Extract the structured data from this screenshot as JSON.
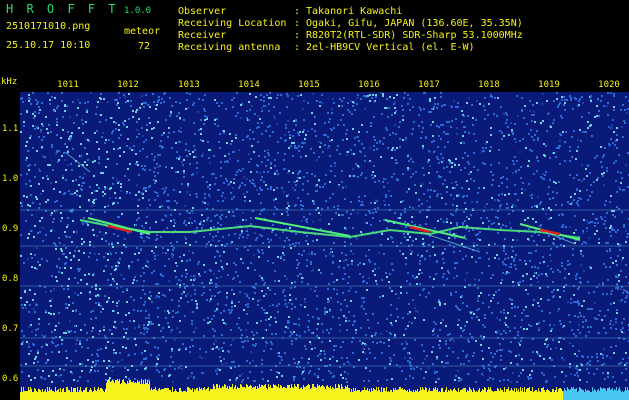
{
  "app": {
    "logo": "H R O F F T",
    "version": "1.0.0",
    "filename": "2510171010.png",
    "category": "meteor",
    "datetime": "25.10.17 10:10",
    "count": "72"
  },
  "meta": [
    {
      "label": "Observer",
      "value": "Takanori Kawachi"
    },
    {
      "label": "Receiving Location",
      "value": "Ogaki, Gifu, JAPAN (136.60E, 35.35N)"
    },
    {
      "label": "Receiver",
      "value": "R820T2(RTL-SDR) SDR-Sharp 53.1000MHz"
    },
    {
      "label": "Receiving antenna",
      "value": "2el-HB9CV Vertical (el. E-W)"
    }
  ],
  "axis": {
    "unit": "kHz",
    "x_ticks": [
      "1011",
      "1012",
      "1013",
      "1014",
      "1015",
      "1016",
      "1017",
      "1018",
      "1019",
      "1020"
    ],
    "y_ticks": [
      "1.1",
      "1.0",
      "0.9",
      "0.8",
      "0.7",
      "0.6"
    ]
  },
  "colors": {
    "noise_dark": "#0a1a78",
    "noise_mid": "#2a6ad8",
    "noise_light": "#6fd0e8",
    "signal_green": "#4ff07a",
    "signal_red": "#e02020",
    "power_bar": "#f6f21c",
    "power_bar_right": "#48c8f0"
  }
}
